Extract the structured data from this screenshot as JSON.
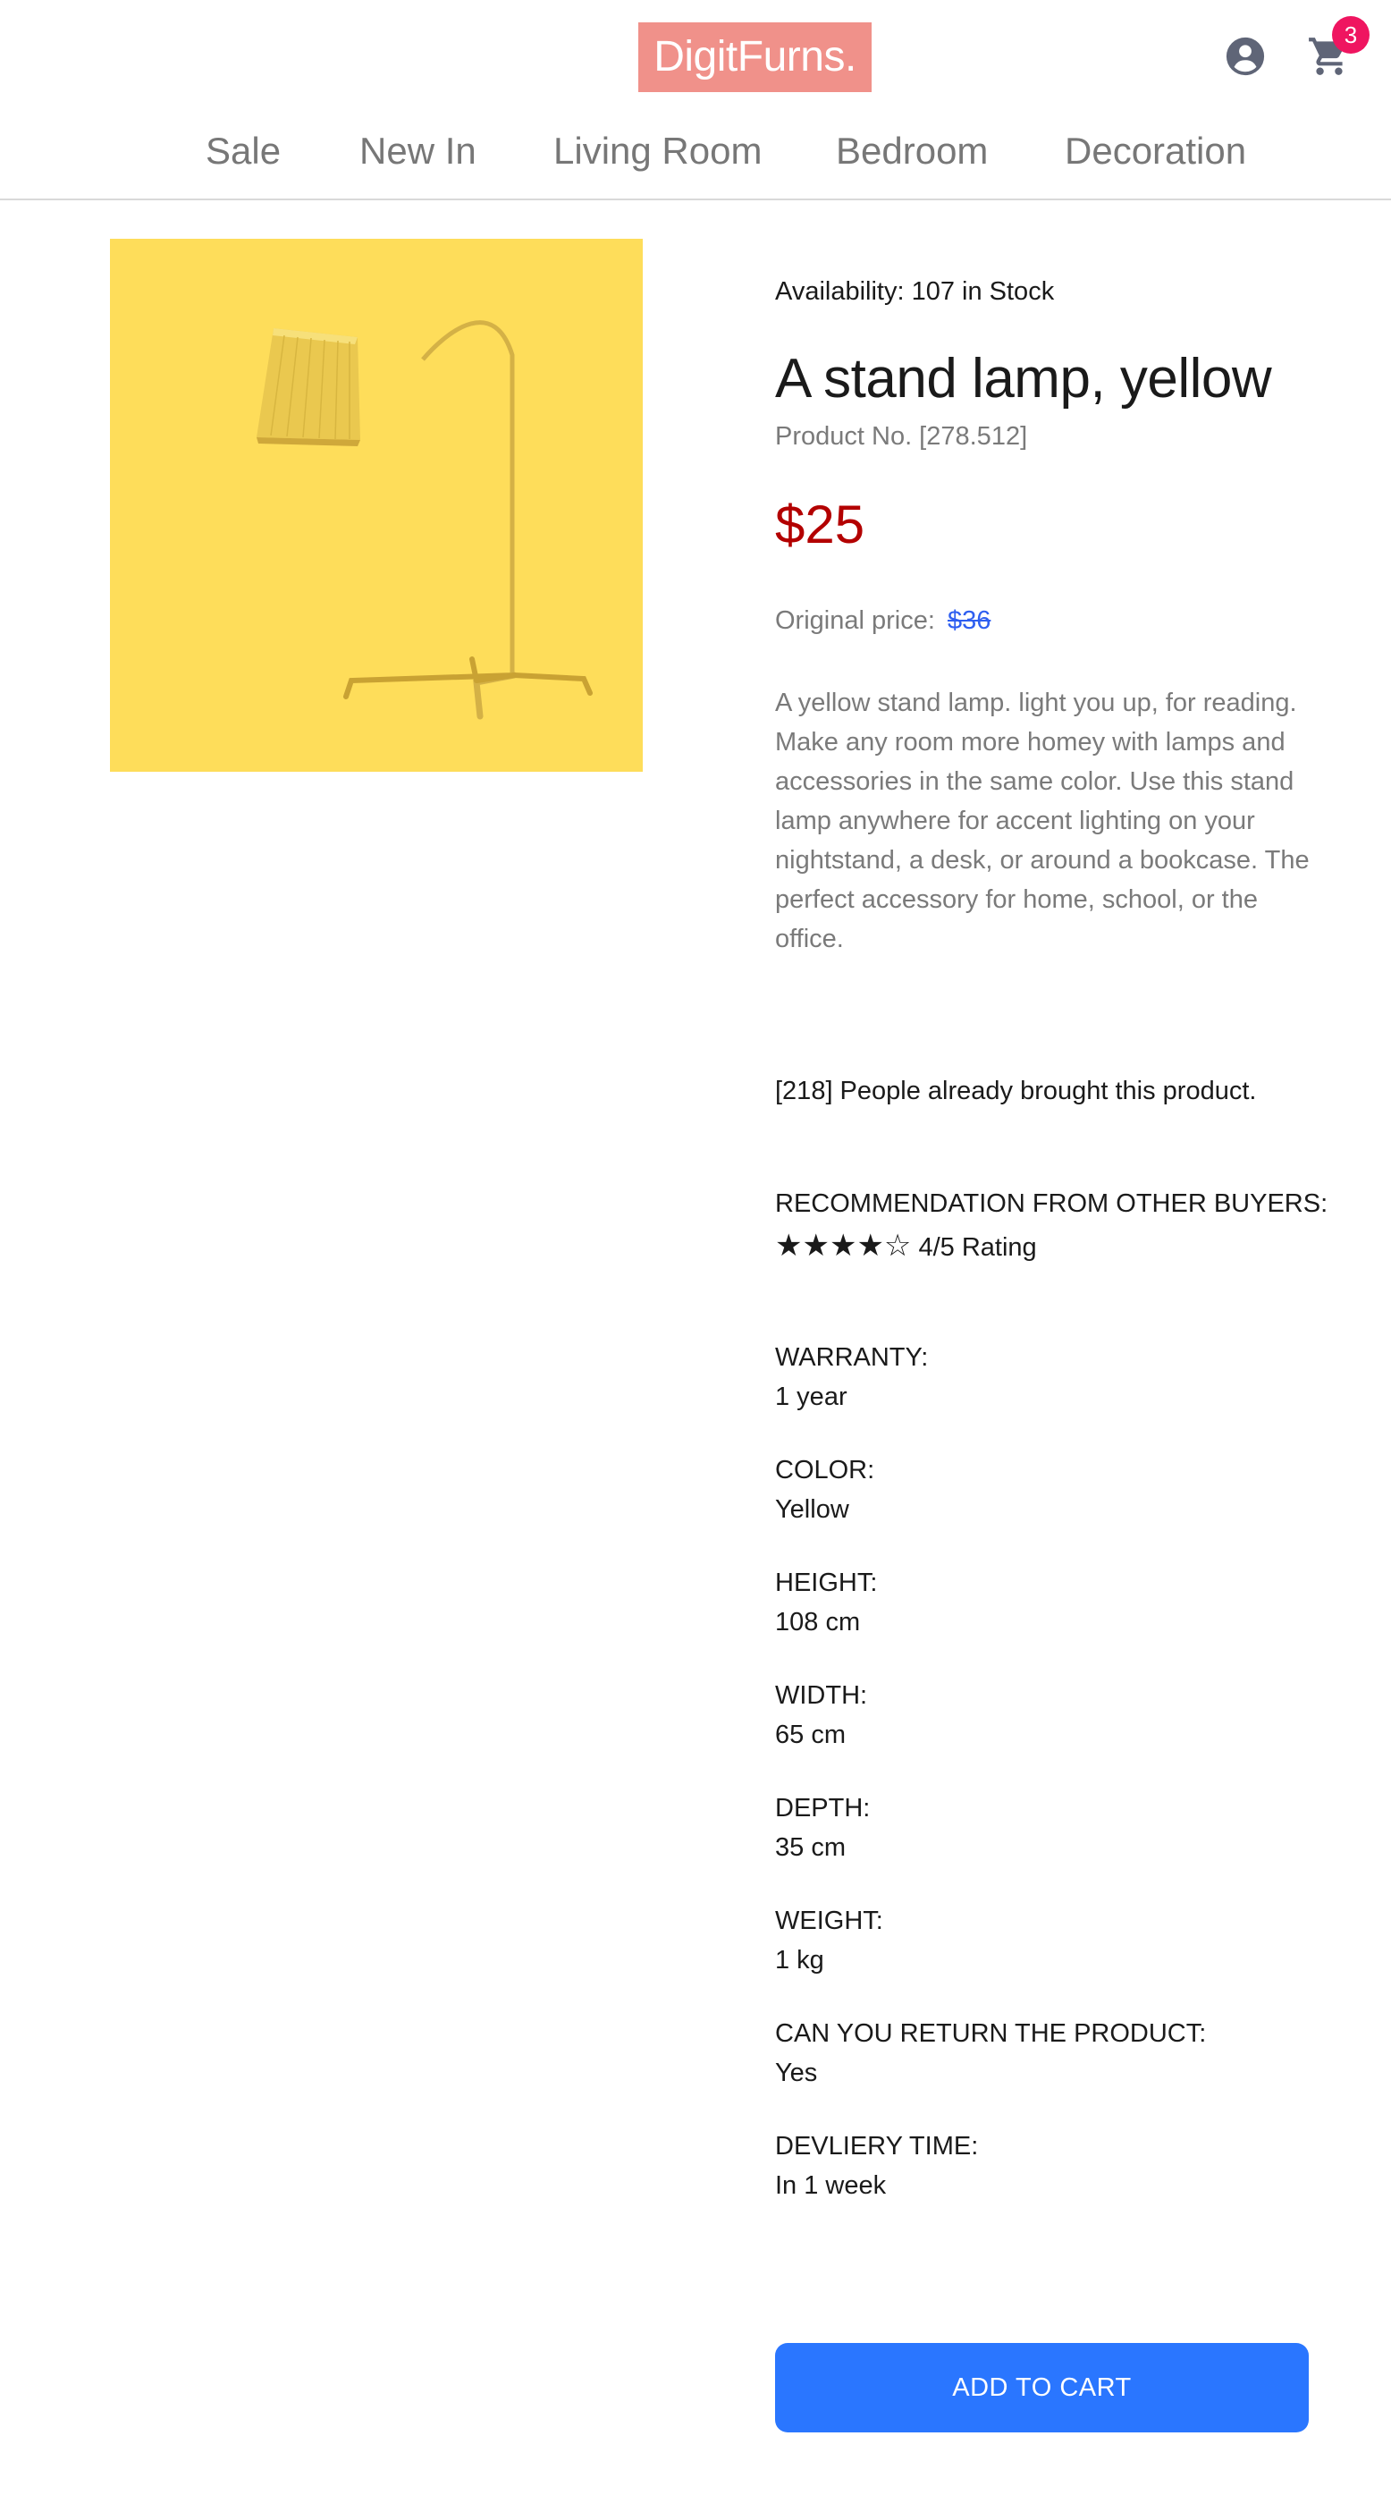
{
  "header": {
    "logo": "DigitFurns.",
    "cart_count": "3",
    "nav": [
      "Sale",
      "New In",
      "Living Room",
      "Bedroom",
      "Decoration"
    ]
  },
  "product": {
    "availability": "Availability: 107 in Stock",
    "title": "A stand lamp, yellow",
    "product_no": "Product No. [278.512]",
    "price": "$25",
    "original_price_label": "Original price:",
    "original_price": "$36",
    "description": "A yellow stand lamp. light you up, for reading. Make any room more homey with lamps and accessories in the same color. Use this stand lamp anywhere for accent lighting on your nightstand, a desk, or around a bookcase. The perfect accessory for home, school, or the office.",
    "bought_text": "[218] People already brought this product.",
    "recommendation_label": "RECOMMENDATION FROM OTHER BUYERS:",
    "rating_stars": "★★★★☆",
    "rating_text": "4/5 Rating",
    "rating_value": 4,
    "rating_max": 5,
    "specs": [
      {
        "label": "WARRANTY:",
        "value": "1 year"
      },
      {
        "label": "COLOR:",
        "value": "Yellow"
      },
      {
        "label": "HEIGHT:",
        "value": "108 cm"
      },
      {
        "label": "WIDTH:",
        "value": "65 cm"
      },
      {
        "label": "DEPTH:",
        "value": "35 cm"
      },
      {
        "label": "WEIGHT:",
        "value": "1 kg"
      },
      {
        "label": "CAN YOU RETURN THE PRODUCT:",
        "value": "Yes"
      },
      {
        "label": "DEVLIERY TIME:",
        "value": "In 1 week"
      }
    ],
    "add_to_cart": "ADD TO CART"
  },
  "colors": {
    "logo_bg": "#f0918a",
    "badge": "#ef1560",
    "price": "#b30000",
    "strike_price": "#2f5ff0",
    "button": "#2a76ff",
    "image_bg": "#fedd5a"
  },
  "icons": [
    "user-account-icon",
    "shopping-cart-icon"
  ]
}
